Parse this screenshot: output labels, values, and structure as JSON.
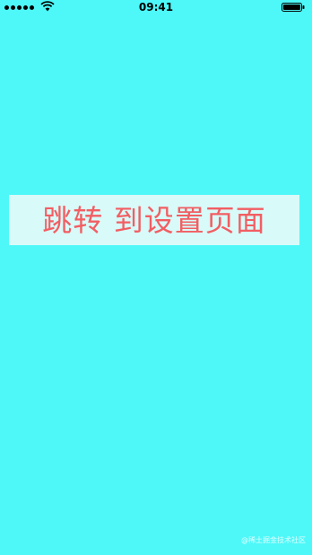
{
  "status_bar": {
    "time": "09:41",
    "signal_icon": "signal-dots-icon",
    "wifi_icon": "wifi-icon",
    "battery_icon": "battery-icon"
  },
  "main": {
    "button_label": "跳转 到设置页面",
    "background_color": "#4ef8f8",
    "button_background": "#d8faf8",
    "button_text_color": "#f25e63"
  },
  "watermark": {
    "text": "@稀土掘金技术社区"
  }
}
